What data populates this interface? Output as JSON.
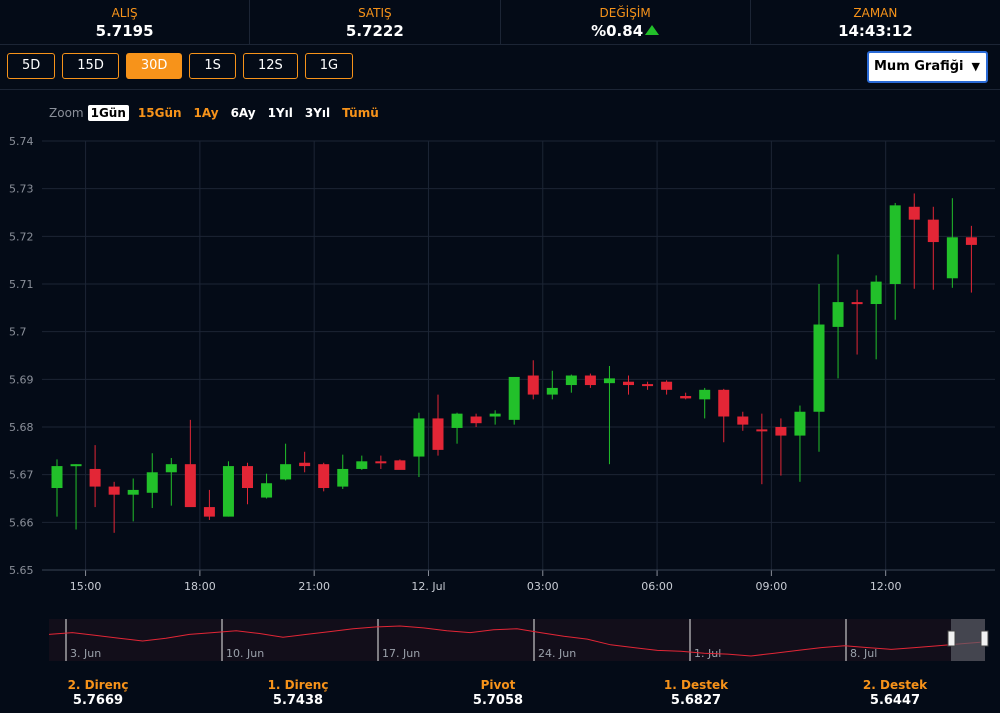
{
  "stats": [
    {
      "label": "ALIŞ",
      "value": "5.7195"
    },
    {
      "label": "SATIŞ",
      "value": "5.7222"
    },
    {
      "label": "DEĞİŞİM",
      "value": "%0.84",
      "direction": "up"
    },
    {
      "label": "ZAMAN",
      "value": "14:43:12"
    }
  ],
  "range_buttons": [
    "5D",
    "15D",
    "30D",
    "1S",
    "12S",
    "1G"
  ],
  "range_active": "30D",
  "chart_type": {
    "selected": "Mum Grafiği"
  },
  "zoom": {
    "label": "Zoom",
    "options": [
      "1Gün",
      "15Gün",
      "1Ay",
      "6Ay",
      "1Yıl",
      "3Yıl",
      "Tümü"
    ],
    "selected": "1Gün",
    "highlighted": [
      "15Gün",
      "1Ay",
      "Tümü"
    ]
  },
  "colors": {
    "up": "#22c02a",
    "down": "#e32636",
    "accent": "#f7931a",
    "background": "#040b17",
    "grid": "#1c2535"
  },
  "chart_data": {
    "type": "candlestick",
    "y_ticks": [
      "5.74",
      "5.73",
      "5.72",
      "5.71",
      "5.7",
      "5.69",
      "5.68",
      "5.67",
      "5.66",
      "5.65"
    ],
    "ylim": [
      5.65,
      5.74
    ],
    "x_ticks": [
      {
        "label": "15:00",
        "index": 1
      },
      {
        "label": "18:00",
        "index": 7
      },
      {
        "label": "21:00",
        "index": 13
      },
      {
        "label": "12. Jul",
        "index": 19
      },
      {
        "label": "03:00",
        "index": 25
      },
      {
        "label": "06:00",
        "index": 31
      },
      {
        "label": "09:00",
        "index": 37
      },
      {
        "label": "12:00",
        "index": 43
      }
    ],
    "grid": true,
    "candles": [
      {
        "o": 5.6672,
        "h": 5.6732,
        "l": 5.6612,
        "c": 5.6718
      },
      {
        "o": 5.6718,
        "h": 5.6722,
        "l": 5.6585,
        "c": 5.6722
      },
      {
        "o": 5.6712,
        "h": 5.6762,
        "l": 5.6632,
        "c": 5.6675
      },
      {
        "o": 5.6675,
        "h": 5.6685,
        "l": 5.6578,
        "c": 5.6658
      },
      {
        "o": 5.6658,
        "h": 5.6692,
        "l": 5.6602,
        "c": 5.6668
      },
      {
        "o": 5.6662,
        "h": 5.6745,
        "l": 5.663,
        "c": 5.6705
      },
      {
        "o": 5.6705,
        "h": 5.6735,
        "l": 5.6635,
        "c": 5.6722
      },
      {
        "o": 5.6722,
        "h": 5.6815,
        "l": 5.6635,
        "c": 5.6632
      },
      {
        "o": 5.6632,
        "h": 5.6668,
        "l": 5.6605,
        "c": 5.6612
      },
      {
        "o": 5.6612,
        "h": 5.6728,
        "l": 5.6612,
        "c": 5.6718
      },
      {
        "o": 5.6718,
        "h": 5.6725,
        "l": 5.6638,
        "c": 5.6672
      },
      {
        "o": 5.6652,
        "h": 5.6702,
        "l": 5.665,
        "c": 5.6682
      },
      {
        "o": 5.669,
        "h": 5.6765,
        "l": 5.6688,
        "c": 5.6722
      },
      {
        "o": 5.6725,
        "h": 5.6748,
        "l": 5.6705,
        "c": 5.6718
      },
      {
        "o": 5.6722,
        "h": 5.6725,
        "l": 5.6665,
        "c": 5.6672
      },
      {
        "o": 5.6675,
        "h": 5.6742,
        "l": 5.667,
        "c": 5.6712
      },
      {
        "o": 5.6712,
        "h": 5.674,
        "l": 5.671,
        "c": 5.6728
      },
      {
        "o": 5.6728,
        "h": 5.674,
        "l": 5.6712,
        "c": 5.6725
      },
      {
        "o": 5.673,
        "h": 5.6732,
        "l": 5.6712,
        "c": 5.671
      },
      {
        "o": 5.6738,
        "h": 5.683,
        "l": 5.6695,
        "c": 5.6818
      },
      {
        "o": 5.6818,
        "h": 5.6868,
        "l": 5.674,
        "c": 5.6752
      },
      {
        "o": 5.6798,
        "h": 5.683,
        "l": 5.6765,
        "c": 5.6828
      },
      {
        "o": 5.6822,
        "h": 5.6828,
        "l": 5.68,
        "c": 5.6808
      },
      {
        "o": 5.6822,
        "h": 5.6835,
        "l": 5.6805,
        "c": 5.6828
      },
      {
        "o": 5.6815,
        "h": 5.6902,
        "l": 5.6805,
        "c": 5.6905
      },
      {
        "o": 5.6908,
        "h": 5.694,
        "l": 5.6858,
        "c": 5.6868
      },
      {
        "o": 5.6868,
        "h": 5.6918,
        "l": 5.6858,
        "c": 5.6882
      },
      {
        "o": 5.6888,
        "h": 5.691,
        "l": 5.6872,
        "c": 5.6908
      },
      {
        "o": 5.6908,
        "h": 5.6912,
        "l": 5.6882,
        "c": 5.6888
      },
      {
        "o": 5.6892,
        "h": 5.6928,
        "l": 5.6722,
        "c": 5.6902
      },
      {
        "o": 5.6895,
        "h": 5.6908,
        "l": 5.6868,
        "c": 5.6888
      },
      {
        "o": 5.689,
        "h": 5.6895,
        "l": 5.6878,
        "c": 5.6888
      },
      {
        "o": 5.6895,
        "h": 5.6898,
        "l": 5.6868,
        "c": 5.6878
      },
      {
        "o": 5.6865,
        "h": 5.6872,
        "l": 5.6858,
        "c": 5.686
      },
      {
        "o": 5.6858,
        "h": 5.6882,
        "l": 5.6818,
        "c": 5.6878
      },
      {
        "o": 5.6878,
        "h": 5.688,
        "l": 5.6768,
        "c": 5.6822
      },
      {
        "o": 5.6822,
        "h": 5.6832,
        "l": 5.6792,
        "c": 5.6805
      },
      {
        "o": 5.6795,
        "h": 5.6828,
        "l": 5.668,
        "c": 5.6792
      },
      {
        "o": 5.68,
        "h": 5.6818,
        "l": 5.6698,
        "c": 5.6782
      },
      {
        "o": 5.6782,
        "h": 5.6845,
        "l": 5.6685,
        "c": 5.6832
      },
      {
        "o": 5.6832,
        "h": 5.71,
        "l": 5.6748,
        "c": 5.7015
      },
      {
        "o": 5.701,
        "h": 5.7162,
        "l": 5.6902,
        "c": 5.7062
      },
      {
        "o": 5.7062,
        "h": 5.7088,
        "l": 5.6952,
        "c": 5.7058
      },
      {
        "o": 5.7058,
        "h": 5.7118,
        "l": 5.6942,
        "c": 5.7105
      },
      {
        "o": 5.71,
        "h": 5.727,
        "l": 5.7025,
        "c": 5.7265
      },
      {
        "o": 5.7262,
        "h": 5.729,
        "l": 5.709,
        "c": 5.7235
      },
      {
        "o": 5.7235,
        "h": 5.7262,
        "l": 5.7088,
        "c": 5.7188
      },
      {
        "o": 5.7112,
        "h": 5.728,
        "l": 5.7092,
        "c": 5.7198
      },
      {
        "o": 5.7198,
        "h": 5.7222,
        "l": 5.7082,
        "c": 5.7182
      }
    ]
  },
  "navigator": {
    "labels": [
      "3. Jun",
      "10. Jun",
      "17. Jun",
      "24. Jun",
      "1. Jul",
      "8. Jul"
    ],
    "series": [
      5.72,
      5.722,
      5.719,
      5.716,
      5.713,
      5.716,
      5.72,
      5.722,
      5.724,
      5.721,
      5.717,
      5.72,
      5.723,
      5.726,
      5.728,
      5.729,
      5.727,
      5.724,
      5.722,
      5.725,
      5.726,
      5.722,
      5.718,
      5.715,
      5.709,
      5.706,
      5.703,
      5.702,
      5.7,
      5.699,
      5.697,
      5.7,
      5.703,
      5.706,
      5.708,
      5.706,
      5.704,
      5.706,
      5.708,
      5.71,
      5.712
    ]
  },
  "levels": [
    {
      "label": "2. Direnç",
      "value": "5.7669"
    },
    {
      "label": "1. Direnç",
      "value": "5.7438"
    },
    {
      "label": "Pivot",
      "value": "5.7058"
    },
    {
      "label": "1. Destek",
      "value": "5.6827"
    },
    {
      "label": "2. Destek",
      "value": "5.6447"
    }
  ]
}
